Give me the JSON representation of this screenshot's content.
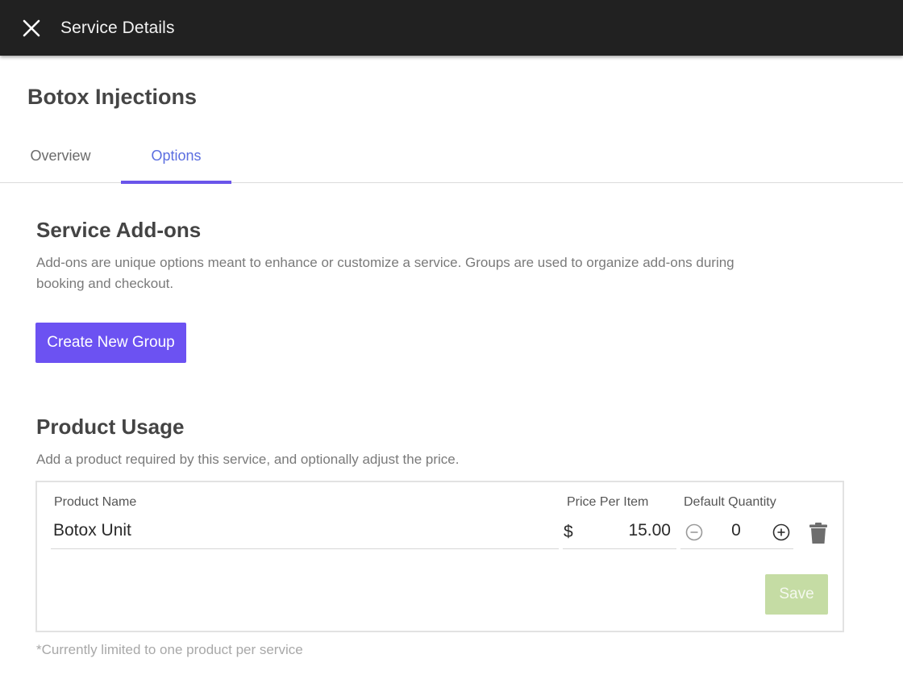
{
  "header": {
    "title": "Service Details",
    "close_icon": "close-icon"
  },
  "service": {
    "name": "Botox Injections"
  },
  "tabs": [
    {
      "label": "Overview",
      "active": false
    },
    {
      "label": "Options",
      "active": true
    }
  ],
  "addons": {
    "title": "Service Add-ons",
    "description_line1": "Add-ons are unique options meant to enhance or customize a service. Groups are used to organize add-ons during",
    "description_line2": "booking and checkout.",
    "create_group_label": "Create New Group"
  },
  "product_usage": {
    "title": "Product Usage",
    "description": "Add a product required by this service, and optionally adjust the price.",
    "columns": {
      "product_name": "Product Name",
      "price_per_item": "Price Per Item",
      "default_quantity": "Default Quantity"
    },
    "row": {
      "product_name": "Botox Unit",
      "currency_symbol": "$",
      "price": "15.00",
      "quantity": "0"
    },
    "save_label": "Save",
    "footnote": "*Currently limited to one product per service"
  },
  "colors": {
    "topbar": "#212121",
    "accent_purple": "#6c52f2",
    "active_tab_text": "#5b6ee0",
    "save_disabled": "#c5dca4"
  }
}
